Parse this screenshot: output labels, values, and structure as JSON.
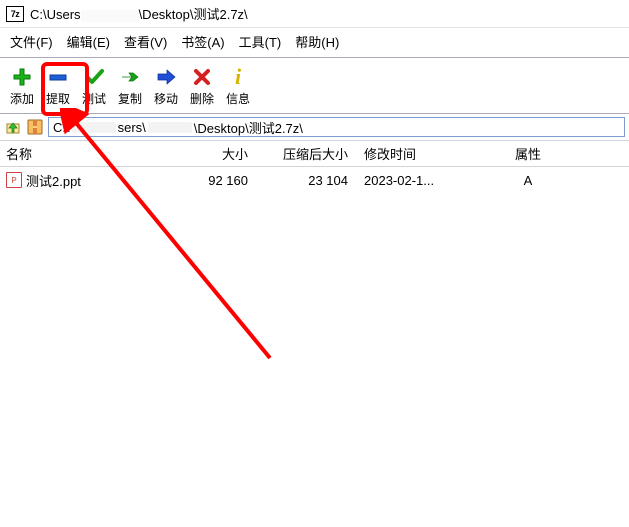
{
  "title": {
    "prefix": "C:\\Users",
    "suffix": "\\Desktop\\测试2.7z\\"
  },
  "menu": {
    "file": "文件(F)",
    "edit": "编辑(E)",
    "view": "查看(V)",
    "bookmarks": "书签(A)",
    "tools": "工具(T)",
    "help": "帮助(H)"
  },
  "toolbar": {
    "add": "添加",
    "extract": "提取",
    "test": "测试",
    "copy": "复制",
    "move": "移动",
    "delete": "删除",
    "info": "信息"
  },
  "path": {
    "prefix": "C:\\",
    "mid1": "sers\\",
    "suffix": "\\Desktop\\测试2.7z\\"
  },
  "columns": {
    "name": "名称",
    "size": "大小",
    "packed": "压缩后大小",
    "mtime": "修改时间",
    "attr": "属性"
  },
  "rows": [
    {
      "name": "测试2.ppt",
      "size": "92 160",
      "packed": "23 104",
      "mtime": "2023-02-1...",
      "attr": "A"
    }
  ]
}
